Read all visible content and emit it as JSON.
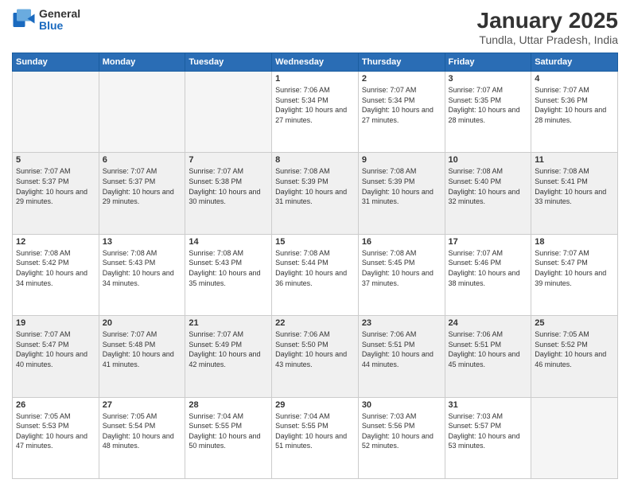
{
  "header": {
    "logo_general": "General",
    "logo_blue": "Blue",
    "month": "January 2025",
    "location": "Tundla, Uttar Pradesh, India"
  },
  "weekdays": [
    "Sunday",
    "Monday",
    "Tuesday",
    "Wednesday",
    "Thursday",
    "Friday",
    "Saturday"
  ],
  "weeks": [
    [
      {
        "day": "",
        "empty": true
      },
      {
        "day": "",
        "empty": true
      },
      {
        "day": "",
        "empty": true
      },
      {
        "day": "1",
        "sunrise": "7:06 AM",
        "sunset": "5:34 PM",
        "daylight": "10 hours and 27 minutes."
      },
      {
        "day": "2",
        "sunrise": "7:07 AM",
        "sunset": "5:34 PM",
        "daylight": "10 hours and 27 minutes."
      },
      {
        "day": "3",
        "sunrise": "7:07 AM",
        "sunset": "5:35 PM",
        "daylight": "10 hours and 28 minutes."
      },
      {
        "day": "4",
        "sunrise": "7:07 AM",
        "sunset": "5:36 PM",
        "daylight": "10 hours and 28 minutes."
      }
    ],
    [
      {
        "day": "5",
        "sunrise": "7:07 AM",
        "sunset": "5:37 PM",
        "daylight": "10 hours and 29 minutes."
      },
      {
        "day": "6",
        "sunrise": "7:07 AM",
        "sunset": "5:37 PM",
        "daylight": "10 hours and 29 minutes."
      },
      {
        "day": "7",
        "sunrise": "7:07 AM",
        "sunset": "5:38 PM",
        "daylight": "10 hours and 30 minutes."
      },
      {
        "day": "8",
        "sunrise": "7:08 AM",
        "sunset": "5:39 PM",
        "daylight": "10 hours and 31 minutes."
      },
      {
        "day": "9",
        "sunrise": "7:08 AM",
        "sunset": "5:39 PM",
        "daylight": "10 hours and 31 minutes."
      },
      {
        "day": "10",
        "sunrise": "7:08 AM",
        "sunset": "5:40 PM",
        "daylight": "10 hours and 32 minutes."
      },
      {
        "day": "11",
        "sunrise": "7:08 AM",
        "sunset": "5:41 PM",
        "daylight": "10 hours and 33 minutes."
      }
    ],
    [
      {
        "day": "12",
        "sunrise": "7:08 AM",
        "sunset": "5:42 PM",
        "daylight": "10 hours and 34 minutes."
      },
      {
        "day": "13",
        "sunrise": "7:08 AM",
        "sunset": "5:43 PM",
        "daylight": "10 hours and 34 minutes."
      },
      {
        "day": "14",
        "sunrise": "7:08 AM",
        "sunset": "5:43 PM",
        "daylight": "10 hours and 35 minutes."
      },
      {
        "day": "15",
        "sunrise": "7:08 AM",
        "sunset": "5:44 PM",
        "daylight": "10 hours and 36 minutes."
      },
      {
        "day": "16",
        "sunrise": "7:08 AM",
        "sunset": "5:45 PM",
        "daylight": "10 hours and 37 minutes."
      },
      {
        "day": "17",
        "sunrise": "7:07 AM",
        "sunset": "5:46 PM",
        "daylight": "10 hours and 38 minutes."
      },
      {
        "day": "18",
        "sunrise": "7:07 AM",
        "sunset": "5:47 PM",
        "daylight": "10 hours and 39 minutes."
      }
    ],
    [
      {
        "day": "19",
        "sunrise": "7:07 AM",
        "sunset": "5:47 PM",
        "daylight": "10 hours and 40 minutes."
      },
      {
        "day": "20",
        "sunrise": "7:07 AM",
        "sunset": "5:48 PM",
        "daylight": "10 hours and 41 minutes."
      },
      {
        "day": "21",
        "sunrise": "7:07 AM",
        "sunset": "5:49 PM",
        "daylight": "10 hours and 42 minutes."
      },
      {
        "day": "22",
        "sunrise": "7:06 AM",
        "sunset": "5:50 PM",
        "daylight": "10 hours and 43 minutes."
      },
      {
        "day": "23",
        "sunrise": "7:06 AM",
        "sunset": "5:51 PM",
        "daylight": "10 hours and 44 minutes."
      },
      {
        "day": "24",
        "sunrise": "7:06 AM",
        "sunset": "5:51 PM",
        "daylight": "10 hours and 45 minutes."
      },
      {
        "day": "25",
        "sunrise": "7:05 AM",
        "sunset": "5:52 PM",
        "daylight": "10 hours and 46 minutes."
      }
    ],
    [
      {
        "day": "26",
        "sunrise": "7:05 AM",
        "sunset": "5:53 PM",
        "daylight": "10 hours and 47 minutes."
      },
      {
        "day": "27",
        "sunrise": "7:05 AM",
        "sunset": "5:54 PM",
        "daylight": "10 hours and 48 minutes."
      },
      {
        "day": "28",
        "sunrise": "7:04 AM",
        "sunset": "5:55 PM",
        "daylight": "10 hours and 50 minutes."
      },
      {
        "day": "29",
        "sunrise": "7:04 AM",
        "sunset": "5:55 PM",
        "daylight": "10 hours and 51 minutes."
      },
      {
        "day": "30",
        "sunrise": "7:03 AM",
        "sunset": "5:56 PM",
        "daylight": "10 hours and 52 minutes."
      },
      {
        "day": "31",
        "sunrise": "7:03 AM",
        "sunset": "5:57 PM",
        "daylight": "10 hours and 53 minutes."
      },
      {
        "day": "",
        "empty": true
      }
    ]
  ],
  "labels": {
    "sunrise": "Sunrise:",
    "sunset": "Sunset:",
    "daylight": "Daylight:"
  }
}
